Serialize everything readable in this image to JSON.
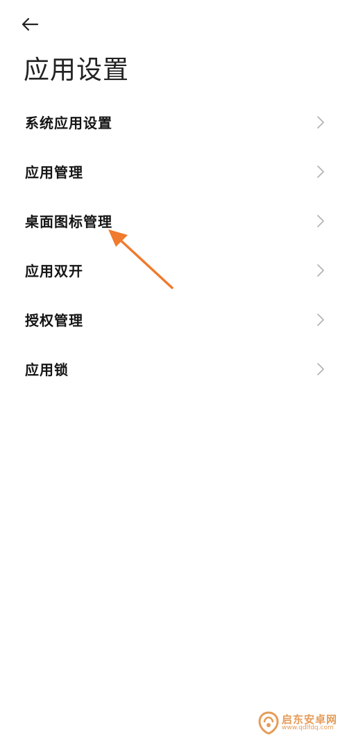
{
  "header": {
    "back_icon": "arrow-left-icon",
    "title": "应用设置"
  },
  "menu": {
    "items": [
      {
        "label": "系统应用设置",
        "icon": "chevron-right-icon"
      },
      {
        "label": "应用管理",
        "icon": "chevron-right-icon"
      },
      {
        "label": "桌面图标管理",
        "icon": "chevron-right-icon"
      },
      {
        "label": "应用双开",
        "icon": "chevron-right-icon"
      },
      {
        "label": "授权管理",
        "icon": "chevron-right-icon"
      },
      {
        "label": "应用锁",
        "icon": "chevron-right-icon"
      }
    ]
  },
  "annotation": {
    "arrow_color": "#f07a2d",
    "points_to": "桌面图标管理"
  },
  "watermark": {
    "name": "启东安卓网",
    "url": "www.qdlfdq.com",
    "color": "#e0832f"
  },
  "colors": {
    "background": "#ffffff",
    "text": "#141414",
    "chevron": "#b0b0b0"
  }
}
